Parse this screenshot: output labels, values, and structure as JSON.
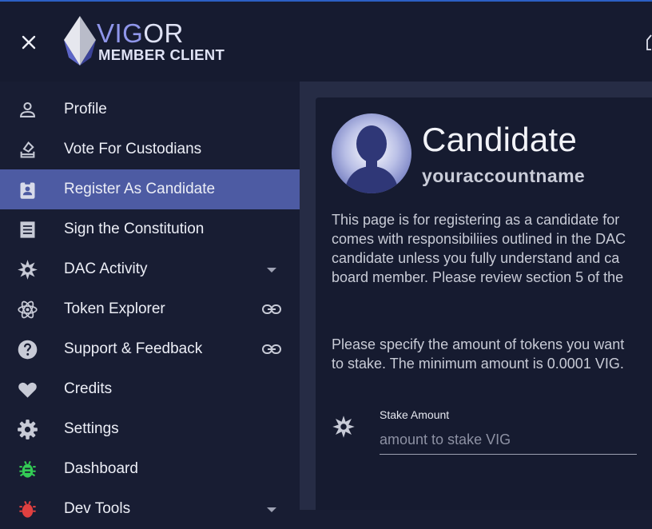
{
  "header": {
    "logo_primary_a": "VIG",
    "logo_primary_b": "OR",
    "logo_secondary": "MEMBER CLIENT",
    "close_icon": "close-icon",
    "right_icon": "translate-icon"
  },
  "sidebar": {
    "items": [
      {
        "label": "Profile",
        "icon": "person-icon",
        "active": false
      },
      {
        "label": "Vote For Custodians",
        "icon": "vote-icon",
        "active": false
      },
      {
        "label": "Register As Candidate",
        "icon": "badge-icon",
        "active": true
      },
      {
        "label": "Sign the Constitution",
        "icon": "document-icon",
        "active": false
      },
      {
        "label": "DAC Activity",
        "icon": "starburst-icon",
        "trailing": "chevron-down-icon"
      },
      {
        "label": "Token Explorer",
        "icon": "atom-icon",
        "trailing": "link-icon"
      },
      {
        "label": "Support & Feedback",
        "icon": "help-icon",
        "trailing": "link-icon"
      },
      {
        "label": "Credits",
        "icon": "heart-icon"
      },
      {
        "label": "Settings",
        "icon": "gear-icon"
      },
      {
        "label": "Dashboard",
        "icon": "bug-icon"
      },
      {
        "label": "Dev Tools",
        "icon": "bug-icon",
        "trailing": "chevron-down-icon"
      }
    ]
  },
  "main": {
    "title": "Candidate",
    "account": "youraccountname",
    "intro_lines": [
      "This page is for registering as a candidate for",
      "comes with responsibiliies outlined in the DAC",
      "candidate unless you fully understand and ca",
      "board member. Please review section 5 of the"
    ],
    "stake_note": "Please specify the amount of tokens you want to stake. The minimum amount is 0.0001 VIG.",
    "stake_label": "Stake Amount",
    "stake_placeholder": "amount to stake VIG",
    "stake_value": ""
  },
  "colors": {
    "background": "#181d33",
    "header": "#161b30",
    "active_item": "#4d5ba3",
    "main_panel": "#262c45",
    "card": "#161b30",
    "accent_top": "#2c5fc4",
    "bug_green": "#33cc55",
    "bug_red": "#e04040"
  }
}
